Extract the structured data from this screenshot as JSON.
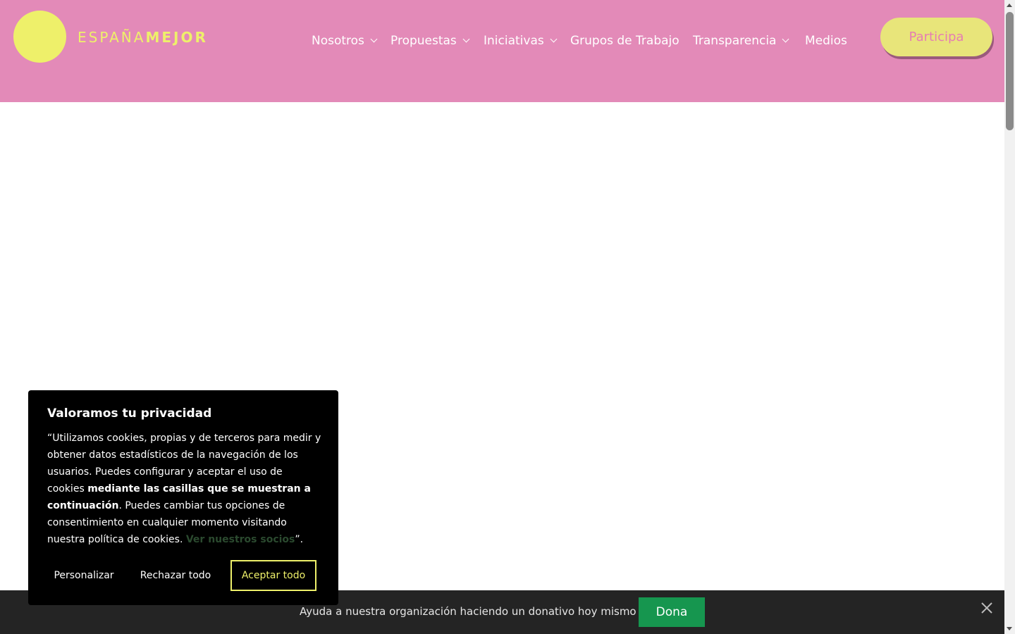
{
  "header": {
    "logo": {
      "light": "ESPAÑA",
      "bold": "MEJOR"
    },
    "nav": [
      {
        "label": "Nosotros",
        "dropdown": true
      },
      {
        "label": "Propuestas",
        "dropdown": true
      },
      {
        "label": "Iniciativas",
        "dropdown": true
      },
      {
        "label": "Grupos de Trabajo",
        "dropdown": false
      },
      {
        "label": "Transparencia",
        "dropdown": true
      },
      {
        "label": "Medios",
        "dropdown": false
      }
    ],
    "cta_label": "Participa"
  },
  "cookie": {
    "title": "Valoramos tu privacidad",
    "text_1": "“Utilizamos cookies, propias y de terceros para medir y obtener datos estadísticos de la navegación de los usuarios. Puedes configurar y aceptar el uso de cookies ",
    "text_bold": "mediante las casillas que se muestran a continuación",
    "text_2": ". Puedes cambiar tus opciones de consentimiento en cualquier momento visitando nuestra política de cookies. ",
    "partners_link": "Ver nuestros socios",
    "text_end": "”.",
    "buttons": {
      "customize": "Personalizar",
      "reject": "Rechazar todo",
      "accept": "Aceptar todo"
    }
  },
  "donation_bar": {
    "text": "Ayuda a nuestra organización haciendo un donativo hoy mismo",
    "button": "Dona",
    "close_icon": "close-icon"
  },
  "colors": {
    "header_bg": "#e38ab8",
    "brand_yellow": "#eef06a",
    "cta_text": "#e67db3",
    "donate_green": "#16964f",
    "bar_bg": "#242424"
  }
}
